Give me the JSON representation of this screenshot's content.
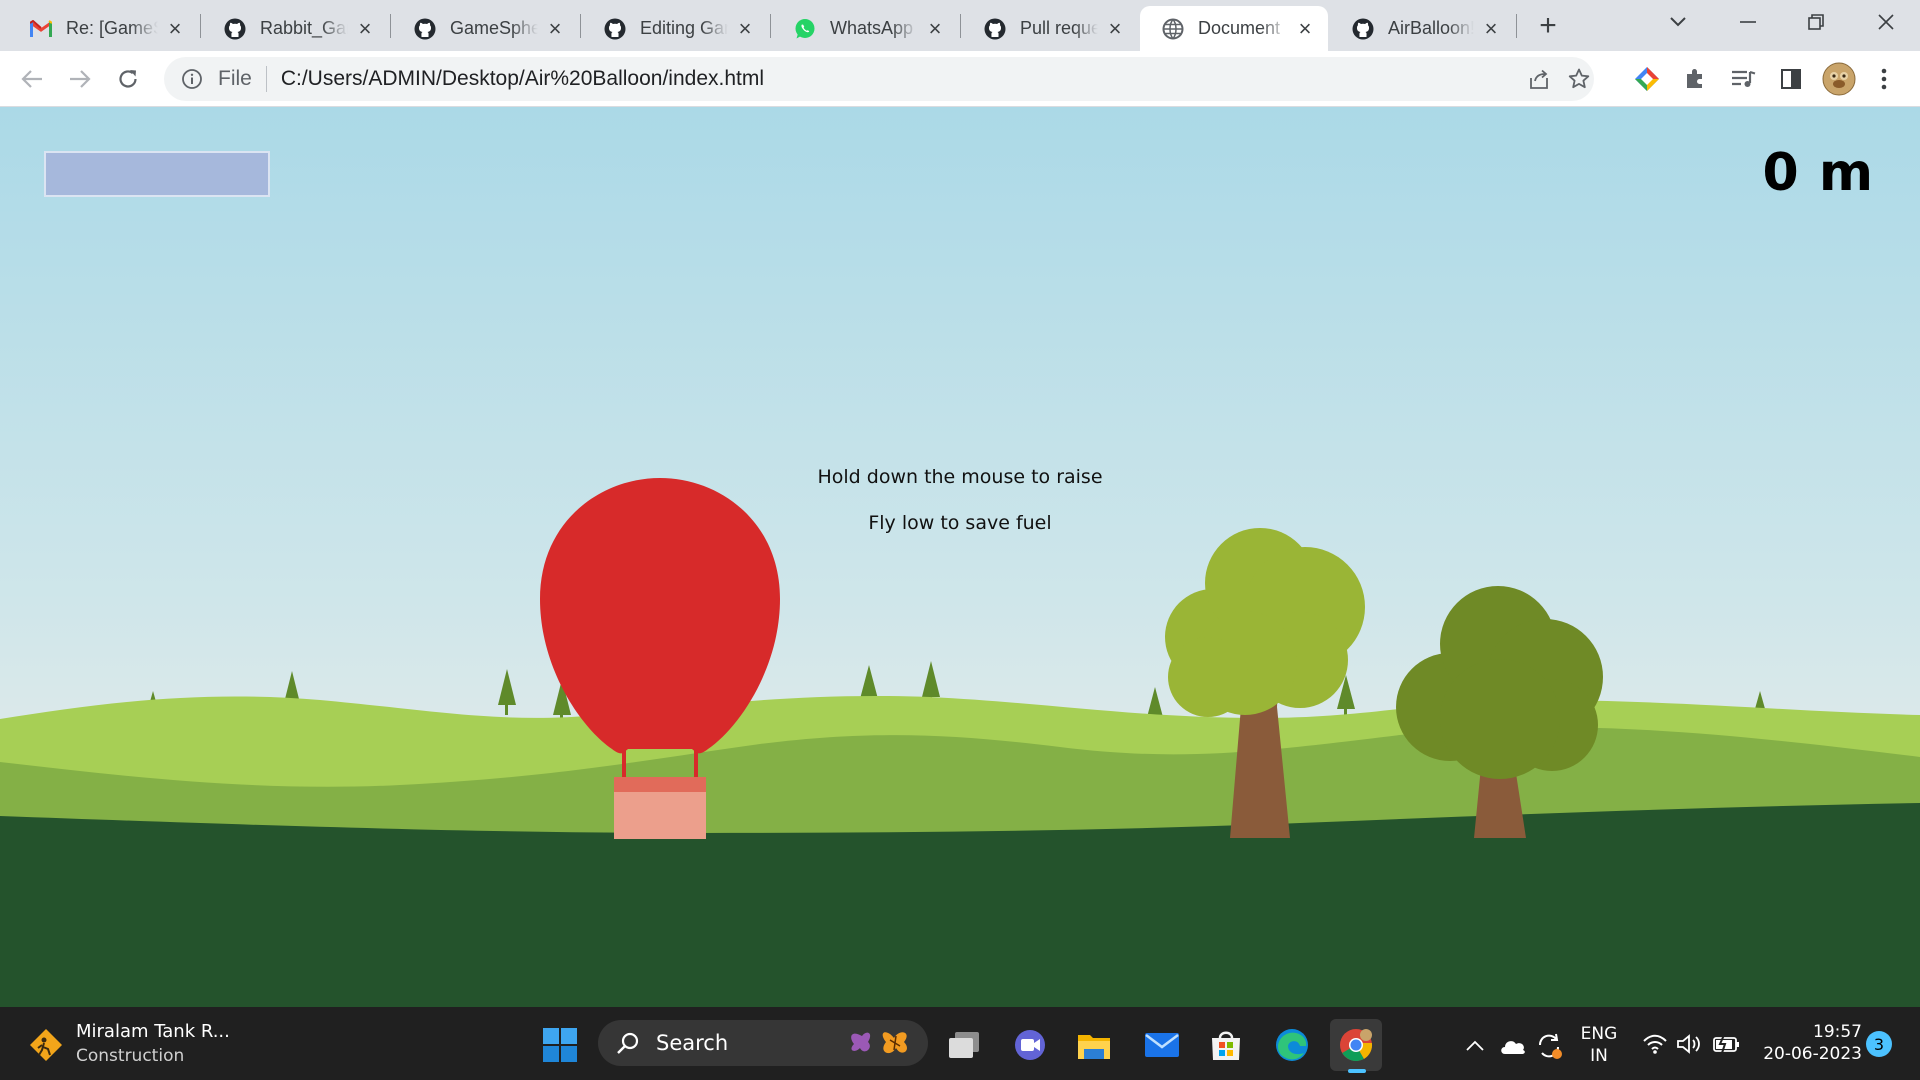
{
  "browser": {
    "tabs": [
      {
        "title": "Re: [GameSphere",
        "icon": "gmail-icon",
        "active": false
      },
      {
        "title": "Rabbit_Game",
        "icon": "github-icon",
        "active": false
      },
      {
        "title": "GameSphere",
        "icon": "github-icon",
        "active": false
      },
      {
        "title": "Editing Game",
        "icon": "github-icon",
        "active": false
      },
      {
        "title": "WhatsApp",
        "icon": "whatsapp-icon",
        "active": false
      },
      {
        "title": "Pull request",
        "icon": "github-icon",
        "active": false
      },
      {
        "title": "Document",
        "icon": "globe-icon",
        "active": true
      },
      {
        "title": "AirBalloon!",
        "icon": "github-icon",
        "active": false
      }
    ],
    "address": {
      "scheme_label": "File",
      "url": "C:/Users/ADMIN/Desktop/Air%20Balloon/index.html"
    }
  },
  "game": {
    "altitude_text": "0 m",
    "fuel_level": 1.0,
    "instructions": [
      "Hold down the mouse to raise",
      "Fly low to save fuel"
    ],
    "colors": {
      "sky_top": "#abd9e7",
      "hill_light": "#a7cf55",
      "hill_mid": "#84b046",
      "ground": "#24532c",
      "balloon": "#d72a2a",
      "basket": "#ec9f8c",
      "basket_rim": "#e16b5a",
      "tree_trunk": "#8a5b3a",
      "canopy_light": "#9ab536",
      "canopy_dark": "#6f8a26",
      "pine": "#5f8a2a",
      "fuel_bar": "#a6b8dc"
    }
  },
  "taskbar": {
    "widget_title": "Miralam Tank R...",
    "widget_subtitle": "Construction",
    "search_label": "Search",
    "language_line1": "ENG",
    "language_line2": "IN",
    "time": "19:57",
    "date": "20-06-2023",
    "notification_count": "3"
  }
}
